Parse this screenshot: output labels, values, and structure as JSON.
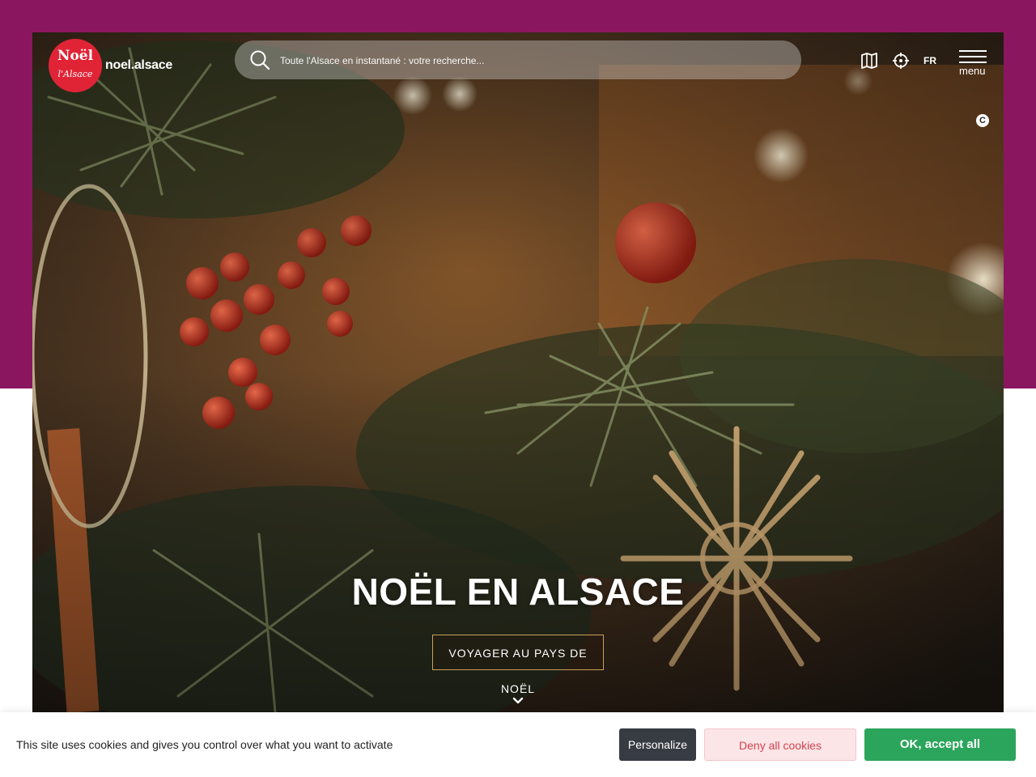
{
  "header": {
    "logo": {
      "top_text": "Noël",
      "bottom_text": "l'Alsace"
    },
    "site_name": "noel.alsace",
    "search": {
      "placeholder": "Toute l'Alsace en instantané : votre recherche..."
    },
    "icons": [
      "map-icon",
      "locate-icon"
    ],
    "language": "FR",
    "menu_label": "menu",
    "copyright_label": "C"
  },
  "hero": {
    "title": "NOËL EN ALSACE",
    "cta_label": "VOYAGER AU PAYS DE NOËL"
  },
  "cookie_bar": {
    "message": "This site uses cookies and gives you control over what you want to activate",
    "personalize_label": "Personalize",
    "deny_label": "Deny all cookies",
    "accept_label": "OK, accept all"
  },
  "colors": {
    "brand": "#8b1660",
    "logo_red": "#e02436",
    "accept_green": "#2ca55c",
    "deny_text": "#d3424f",
    "personalize_bg": "#373c43"
  }
}
